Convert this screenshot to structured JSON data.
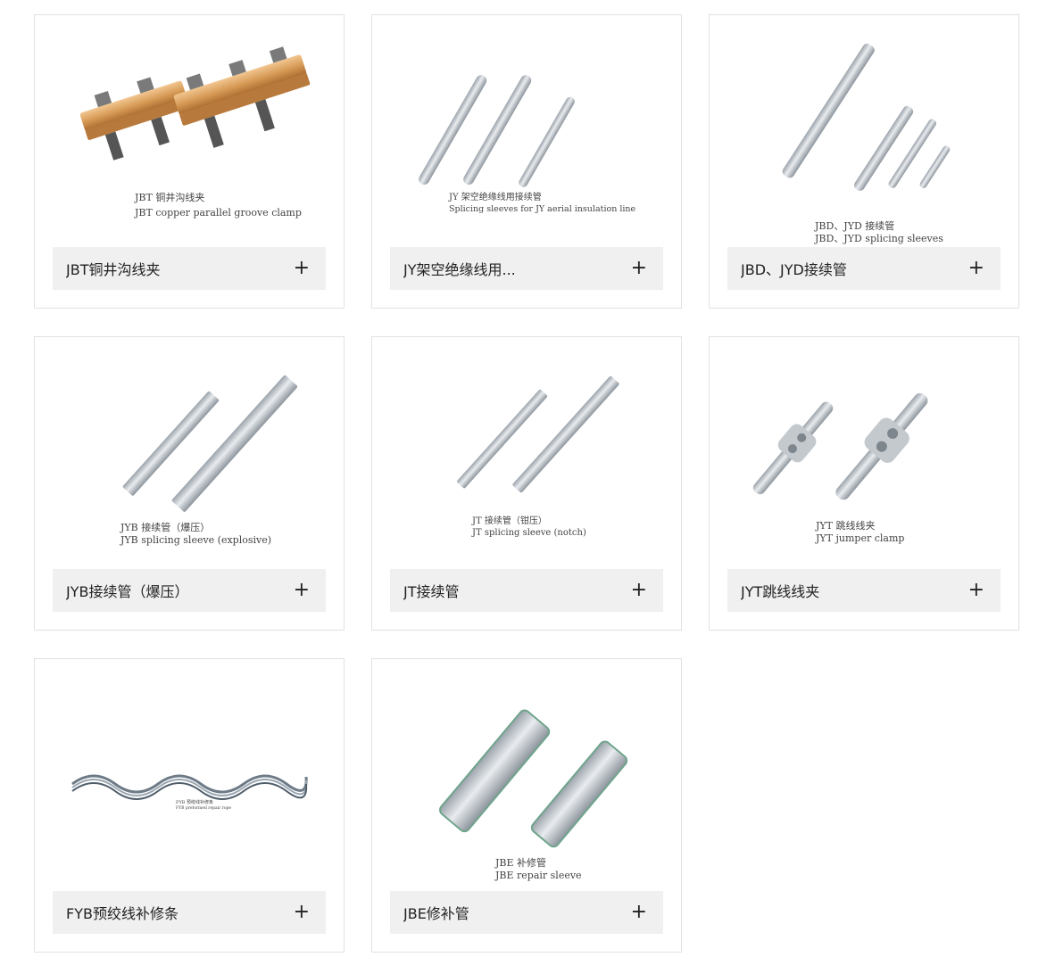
{
  "products": [
    {
      "title": "JBT铜井沟线夹",
      "caption_cn": "JBT 铜井沟线夹",
      "caption_en": "JBT copper parallel groove clamp",
      "action": "+",
      "image": "copper-parallel-groove-clamp"
    },
    {
      "title": "JY架空绝缘线用...",
      "caption_cn": "JY 架空绝缘线用接续管",
      "caption_en": "Splicing sleeves for JY aerial insulation line",
      "action": "+",
      "image": "splicing-sleeves"
    },
    {
      "title": "JBD、JYD接续管",
      "caption_cn": "JBD、JYD 接续管",
      "caption_en": "JBD、JYD splicing sleeves",
      "action": "+",
      "image": "splicing-tubes"
    },
    {
      "title": "JYB接续管（爆压）",
      "caption_cn": "JYB 接续管（爆压）",
      "caption_en": "JYB splicing sleeve (explosive)",
      "action": "+",
      "image": "explosive-splicing-sleeve"
    },
    {
      "title": "JT接续管",
      "caption_cn": "JT 接续管（钳压）",
      "caption_en": "JT splicing sleeve (notch)",
      "action": "+",
      "image": "notch-splicing-sleeve"
    },
    {
      "title": "JYT跳线线夹",
      "caption_cn": "JYT 跳线线夹",
      "caption_en": "JYT jumper clamp",
      "action": "+",
      "image": "jumper-clamp"
    },
    {
      "title": "FYB预绞线补修条",
      "caption_cn": "FYB 预绞线补修条",
      "caption_en": "FYB preformed repair rope",
      "action": "+",
      "image": "preformed-repair-rod"
    },
    {
      "title": "JBE修补管",
      "caption_cn": "JBE 补修管",
      "caption_en": "JBE repair sleeve",
      "action": "+",
      "image": "repair-sleeve"
    }
  ],
  "colors": {
    "card_border": "#e2e2e2",
    "bar_bg": "#f0f0f0",
    "copper": "#d69a55",
    "metal": "#c9ced3",
    "text": "#222222"
  }
}
